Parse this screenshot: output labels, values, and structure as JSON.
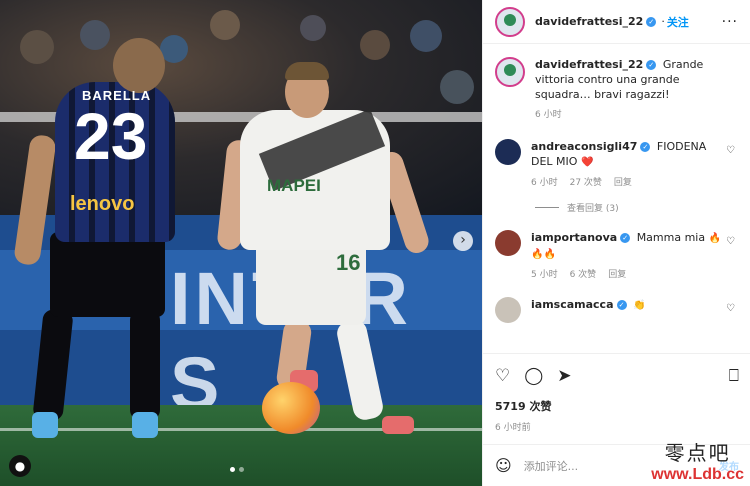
{
  "post": {
    "username": "davidefrattesi_22",
    "follow_label": "关注",
    "more_icon": "more-icon"
  },
  "photo": {
    "player1_name": "BARELLA",
    "player1_number": "23",
    "player1_sponsor": "lenovo",
    "player2_sponsor": "MAPEI",
    "player2_number": "16",
    "board_text": "INTER S",
    "carousel_total": 2,
    "carousel_active": 1
  },
  "caption": {
    "username": "davidefrattesi_22",
    "text": "Grande vittoria contro una grande squadra… bravi ragazzi!",
    "time": "6 小时"
  },
  "comments": [
    {
      "username": "andreaconsigli47",
      "text": "FIODENA DEL MIO",
      "emoji": "❤️",
      "time": "6 小时",
      "likes": "27 次赞",
      "reply": "回复",
      "view_replies": "查看回复 (3)"
    },
    {
      "username": "iamportanova",
      "text": "Mamma mia",
      "emoji": "🔥🔥🔥",
      "time": "5 小时",
      "likes": "6 次赞",
      "reply": "回复"
    },
    {
      "username": "iamscamacca",
      "text": "",
      "emoji": "👏",
      "time": "",
      "likes": "",
      "reply": ""
    }
  ],
  "actions": {
    "likes": "5719 次赞",
    "ago": "6 小时前"
  },
  "composer": {
    "placeholder": "添加评论...",
    "post_label": "发布"
  },
  "watermark": {
    "cn": "零点吧",
    "url": "www.Ldb.cc"
  },
  "colors": {
    "verified": "#3797f0",
    "follow": "#0095f6",
    "heart_emoji": "#e0245e"
  }
}
